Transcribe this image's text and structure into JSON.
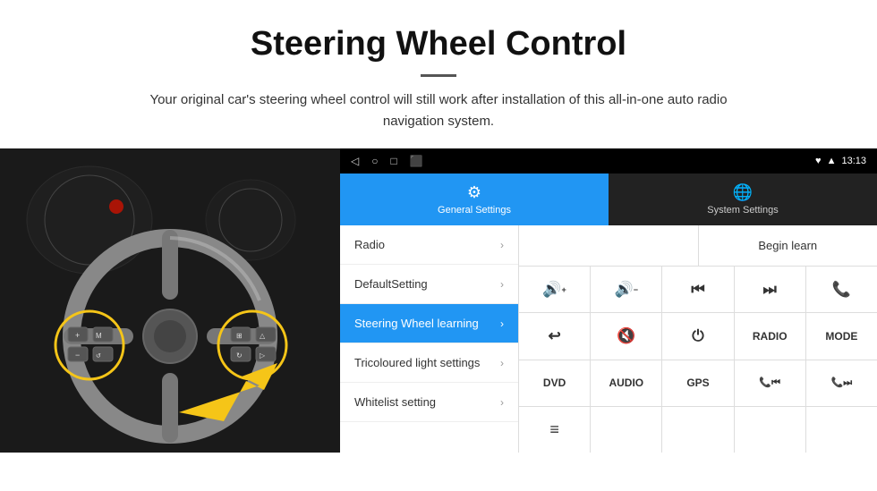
{
  "header": {
    "title": "Steering Wheel Control",
    "subtitle": "Your original car's steering wheel control will still work after installation of this all-in-one auto radio navigation system."
  },
  "statusBar": {
    "time": "13:13",
    "navIcons": [
      "◁",
      "○",
      "□",
      "⬛"
    ],
    "rightIcons": [
      "♥",
      "▲"
    ]
  },
  "tabs": [
    {
      "id": "general",
      "label": "General Settings",
      "icon": "⚙",
      "active": true
    },
    {
      "id": "system",
      "label": "System Settings",
      "icon": "🌐",
      "active": false
    }
  ],
  "menu": {
    "items": [
      {
        "id": "radio",
        "label": "Radio",
        "active": false
      },
      {
        "id": "default",
        "label": "DefaultSetting",
        "active": false
      },
      {
        "id": "steering",
        "label": "Steering Wheel learning",
        "active": true
      },
      {
        "id": "tricoloured",
        "label": "Tricoloured light settings",
        "active": false
      },
      {
        "id": "whitelist",
        "label": "Whitelist setting",
        "active": false
      }
    ]
  },
  "controls": {
    "beginLearn": "Begin learn",
    "rows": [
      [
        {
          "label": "🔊+",
          "type": "icon"
        },
        {
          "label": "🔊−",
          "type": "icon"
        },
        {
          "label": "⏮",
          "type": "icon"
        },
        {
          "label": "⏭",
          "type": "icon"
        },
        {
          "label": "📞",
          "type": "icon"
        }
      ],
      [
        {
          "label": "↩",
          "type": "icon"
        },
        {
          "label": "🔊✕",
          "type": "icon"
        },
        {
          "label": "⏻",
          "type": "icon"
        },
        {
          "label": "RADIO",
          "type": "text"
        },
        {
          "label": "MODE",
          "type": "text"
        }
      ],
      [
        {
          "label": "DVD",
          "type": "text"
        },
        {
          "label": "AUDIO",
          "type": "text"
        },
        {
          "label": "GPS",
          "type": "text"
        },
        {
          "label": "📞⏮",
          "type": "icon"
        },
        {
          "label": "📞⏭",
          "type": "icon"
        }
      ],
      [
        {
          "label": "≡",
          "type": "icon"
        },
        {
          "label": "",
          "type": "empty"
        },
        {
          "label": "",
          "type": "empty"
        },
        {
          "label": "",
          "type": "empty"
        },
        {
          "label": "",
          "type": "empty"
        }
      ]
    ]
  }
}
